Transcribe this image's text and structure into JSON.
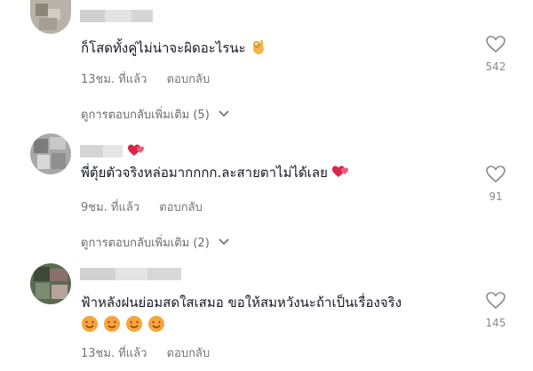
{
  "comments": [
    {
      "text": "ก็โสดทั้งคู่ไม่น่าจะผิดอะไรนะ",
      "time": "13ชม. ที่แล้ว",
      "reply_label": "ตอบกลับ",
      "likes": "542",
      "more_replies": "ดูการตอบกลับเพิ่มเติม (5)",
      "emoji": "ok-hand-emoji"
    },
    {
      "text": "พี่ตุ้ยตัวจริงหล่อมากกกก.ละสายตาไม่ได้เลย",
      "time": "9ชม. ที่แล้ว",
      "reply_label": "ตอบกลับ",
      "likes": "91",
      "more_replies": "ดูการตอบกลับเพิ่มเติม (2)",
      "emoji": "two-hearts-emoji"
    },
    {
      "text": "ฟ้าหลังฝนย่อมสดใสเสมอ ขอให้สมหวังนะถ้าเป็นเรื่องจริง",
      "time": "13ชม. ที่แล้ว",
      "reply_label": "ตอบกลับ",
      "likes": "145",
      "emoji": "smiling-hearts-emoji"
    }
  ],
  "colors": {
    "text": "#161823",
    "meta": "#757575",
    "heart_emoji": "#d8264a",
    "smile_emoji": "#f4a63a"
  }
}
